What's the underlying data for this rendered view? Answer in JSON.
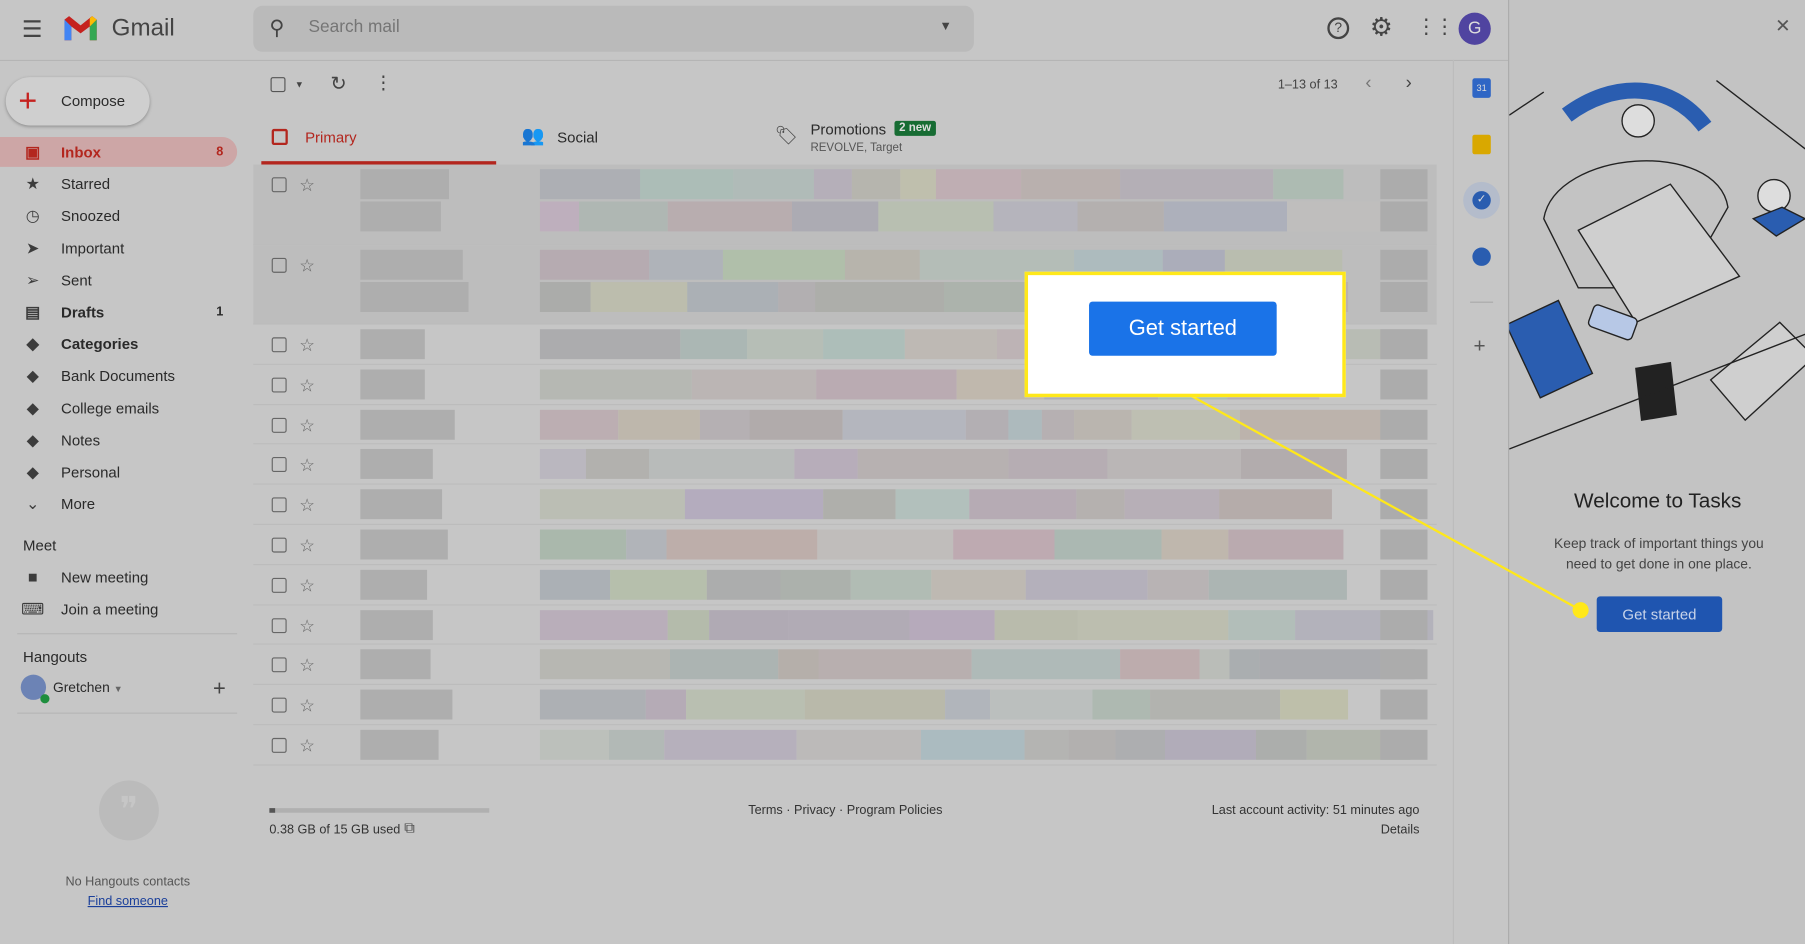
{
  "header": {
    "app_name": "Gmail",
    "search_placeholder": "Search mail",
    "avatar_letter": "G"
  },
  "compose_label": "Compose",
  "sidebar": {
    "items": [
      {
        "label": "Inbox",
        "count": "8",
        "icon": "inbox-icon",
        "active": true
      },
      {
        "label": "Starred",
        "count": "",
        "icon": "star-icon"
      },
      {
        "label": "Snoozed",
        "count": "",
        "icon": "clock-icon"
      },
      {
        "label": "Important",
        "count": "",
        "icon": "important-icon"
      },
      {
        "label": "Sent",
        "count": "",
        "icon": "send-icon"
      },
      {
        "label": "Drafts",
        "count": "1",
        "icon": "draft-icon"
      },
      {
        "label": "Categories",
        "count": "",
        "icon": "label-icon"
      },
      {
        "label": "Bank Documents",
        "count": "",
        "icon": "label-icon"
      },
      {
        "label": "College emails",
        "count": "",
        "icon": "label-icon"
      },
      {
        "label": "Notes",
        "count": "",
        "icon": "label-icon"
      },
      {
        "label": "Personal",
        "count": "",
        "icon": "label-icon"
      },
      {
        "label": "More",
        "count": "",
        "icon": "chevron-down-icon"
      }
    ],
    "meet": {
      "title": "Meet",
      "new_meeting": "New meeting",
      "join_meeting": "Join a meeting"
    },
    "hangouts": {
      "title": "Hangouts",
      "user": "Gretchen",
      "no_contacts": "No Hangouts contacts",
      "find_someone": "Find someone"
    }
  },
  "toolbar": {
    "pagination": "1–13 of 13"
  },
  "tabs": [
    {
      "label": "Primary"
    },
    {
      "label": "Social"
    },
    {
      "label": "Promotions",
      "badge": "2 new",
      "sub": "REVOLVE, Target"
    }
  ],
  "footer": {
    "storage": "0.38 GB of 15 GB used",
    "storage_fraction": 0.025,
    "links": "Terms · Privacy · Program Policies",
    "activity": "Last account activity: 51 minutes ago",
    "details": "Details"
  },
  "tasks": {
    "title": "Welcome to Tasks",
    "description": "Keep track of important things you need to get done in one place.",
    "button": "Get started"
  },
  "callout": {
    "button": "Get started"
  },
  "colors": {
    "accent": "#1a73e8",
    "highlight": "#ffe81a",
    "inbox_red": "#b3261e"
  }
}
